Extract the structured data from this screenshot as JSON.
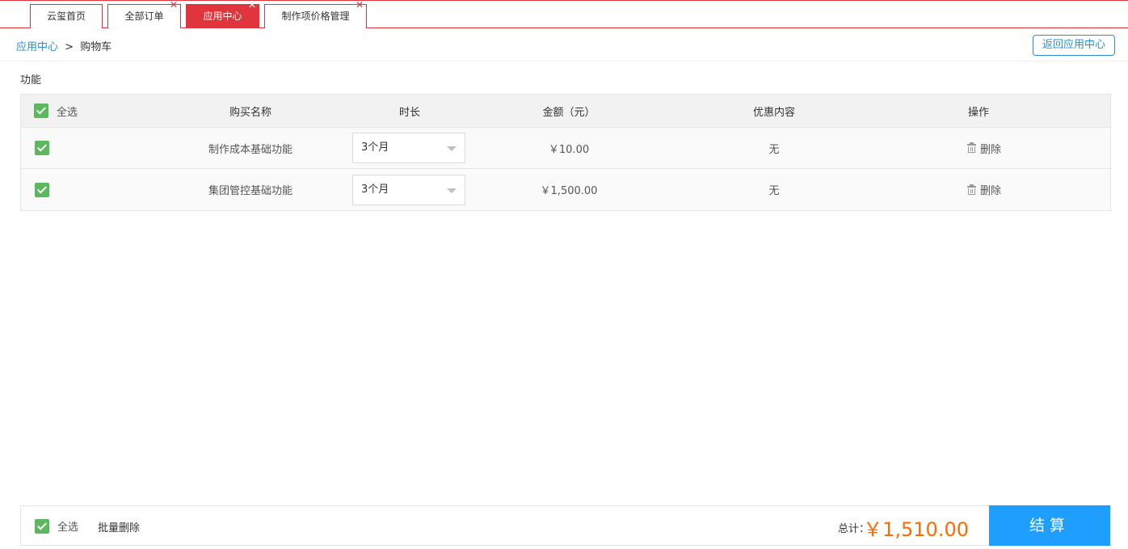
{
  "tabs": [
    {
      "label": "云玺首页",
      "closable": false,
      "active": false
    },
    {
      "label": "全部订单",
      "closable": true,
      "active": false
    },
    {
      "label": "应用中心",
      "closable": true,
      "active": true
    },
    {
      "label": "制作项价格管理",
      "closable": true,
      "active": false
    }
  ],
  "close_glyph": "✕",
  "breadcrumb": {
    "root": "应用中心",
    "separator": ">",
    "current": "购物车"
  },
  "back_button": "返回应用中心",
  "section_label": "功能",
  "table": {
    "headers": {
      "select_all": "全选",
      "name": "购买名称",
      "duration": "时长",
      "amount": "金额（元）",
      "discount": "优惠内容",
      "action": "操作"
    },
    "rows": [
      {
        "checked": true,
        "name": "制作成本基础功能",
        "duration": "3个月",
        "amount": "￥10.00",
        "discount": "无",
        "action": "删除"
      },
      {
        "checked": true,
        "name": "集团管控基础功能",
        "duration": "3个月",
        "amount": "￥1,500.00",
        "discount": "无",
        "action": "删除"
      }
    ]
  },
  "footer": {
    "select_all": "全选",
    "batch_delete": "批量删除",
    "total_label": "总计：",
    "total": "￥1,510.00",
    "checkout": "结算"
  },
  "colors": {
    "accent": "#e0353d",
    "link": "#2a8fd6",
    "checkbox": "#5cb85c",
    "price": "#ff6a00",
    "checkout": "#1e9eff"
  }
}
